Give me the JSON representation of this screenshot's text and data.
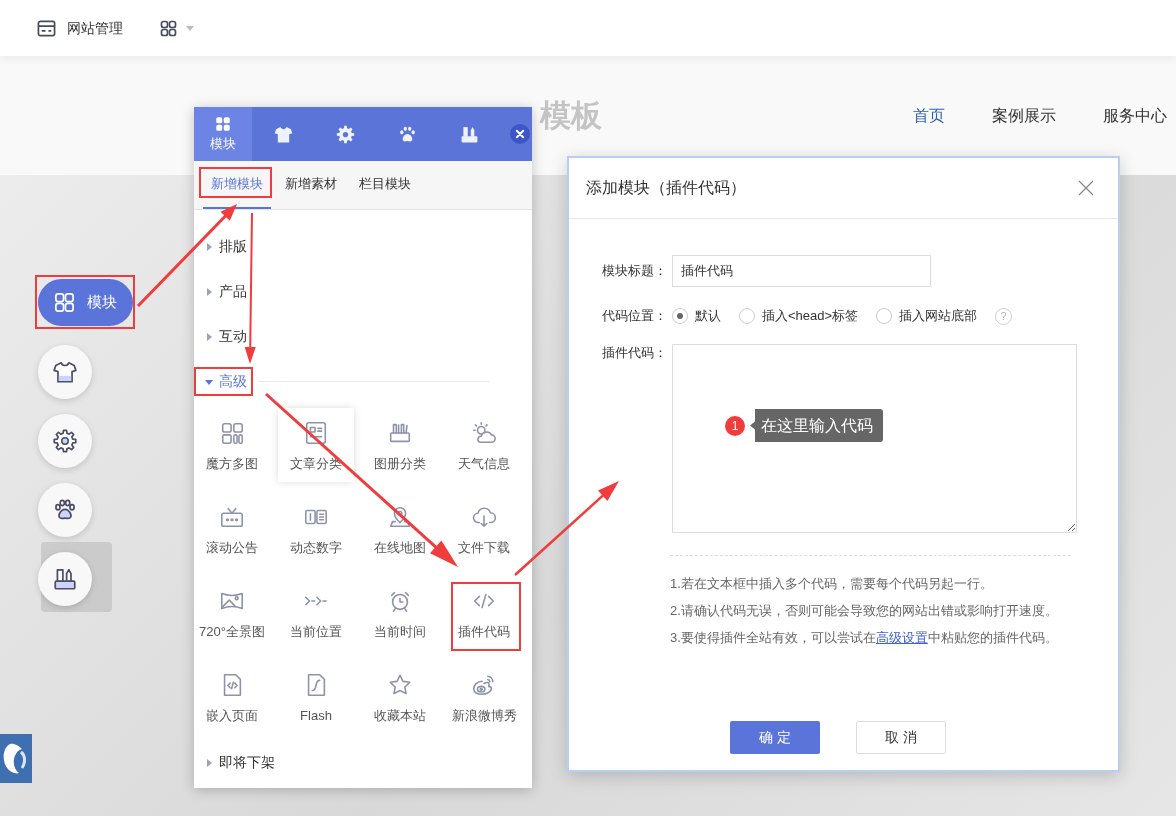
{
  "top_bar": {
    "site_management": "网站管理"
  },
  "site_header": {
    "title": "模板",
    "nav": [
      {
        "label": "首页",
        "selected": true
      },
      {
        "label": "案例展示",
        "selected": false
      },
      {
        "label": "服务中心",
        "selected": false
      }
    ]
  },
  "side_toolbar": [
    {
      "kind": "modules",
      "label": "模块",
      "selected": true,
      "hovered": false,
      "highlighted": true
    },
    {
      "kind": "style",
      "selected": false,
      "hovered": false,
      "highlighted": false
    },
    {
      "kind": "settings",
      "selected": false,
      "hovered": false,
      "highlighted": false
    },
    {
      "kind": "paw",
      "selected": false,
      "hovered": false,
      "highlighted": false
    },
    {
      "kind": "tools",
      "selected": false,
      "hovered": true,
      "highlighted": false
    }
  ],
  "panel": {
    "tabs": [
      {
        "kind": "modules",
        "label": "模块",
        "selected": true
      },
      {
        "kind": "style",
        "selected": false
      },
      {
        "kind": "settings",
        "selected": false
      },
      {
        "kind": "paw",
        "selected": false
      },
      {
        "kind": "tools",
        "selected": false
      }
    ],
    "subtabs": [
      {
        "label": "新增模块",
        "selected": true,
        "highlighted": true
      },
      {
        "label": "新增素材",
        "selected": false,
        "highlighted": false
      },
      {
        "label": "栏目模块",
        "selected": false,
        "highlighted": false
      }
    ],
    "categories": [
      {
        "label": "排版",
        "expanded": false,
        "highlighted": false
      },
      {
        "label": "产品",
        "expanded": false,
        "highlighted": false
      },
      {
        "label": "互动",
        "expanded": false,
        "highlighted": false
      },
      {
        "label": "高级",
        "expanded": true,
        "highlighted": true,
        "items": [
          {
            "kind": "grid",
            "label": "魔方多图",
            "hovered": false,
            "highlighted": false
          },
          {
            "kind": "article",
            "label": "文章分类",
            "hovered": true,
            "highlighted": false
          },
          {
            "kind": "album",
            "label": "图册分类",
            "hovered": false,
            "highlighted": false
          },
          {
            "kind": "weather",
            "label": "天气信息",
            "hovered": false,
            "highlighted": false
          },
          {
            "kind": "notice",
            "label": "滚动公告",
            "hovered": false,
            "highlighted": false
          },
          {
            "kind": "counter",
            "label": "动态数字",
            "hovered": false,
            "highlighted": false
          },
          {
            "kind": "map",
            "label": "在线地图",
            "hovered": false,
            "highlighted": false
          },
          {
            "kind": "download",
            "label": "文件下载",
            "hovered": false,
            "highlighted": false
          },
          {
            "kind": "panorama",
            "label": "720°全景图",
            "hovered": false,
            "highlighted": false
          },
          {
            "kind": "breadcrumb",
            "label": "当前位置",
            "hovered": false,
            "highlighted": false
          },
          {
            "kind": "clock",
            "label": "当前时间",
            "hovered": false,
            "highlighted": false
          },
          {
            "kind": "code",
            "label": "插件代码",
            "hovered": false,
            "highlighted": true
          },
          {
            "kind": "embed",
            "label": "嵌入页面",
            "hovered": false,
            "highlighted": false
          },
          {
            "kind": "flash",
            "label": "Flash",
            "hovered": false,
            "highlighted": false
          },
          {
            "kind": "star",
            "label": "收藏本站",
            "hovered": false,
            "highlighted": false
          },
          {
            "kind": "weibo",
            "label": "新浪微博秀",
            "hovered": false,
            "highlighted": false
          }
        ]
      },
      {
        "label": "即将下架",
        "expanded": false,
        "highlighted": false
      }
    ]
  },
  "dialog": {
    "title": "添加模块（插件代码）",
    "title_field": {
      "label": "模块标题：",
      "value": "插件代码"
    },
    "position_field": {
      "label": "代码位置：",
      "options": [
        {
          "label": "默认",
          "selected": true
        },
        {
          "label": "插入<head>标签",
          "selected": false
        },
        {
          "label": "插入网站底部",
          "selected": false
        }
      ],
      "help": "?"
    },
    "code_field": {
      "label": "插件代码：",
      "hint": {
        "marker": "1",
        "text": "在这里输入代码"
      }
    },
    "notes": [
      {
        "text": "1.若在文本框中插入多个代码，需要每个代码另起一行。"
      },
      {
        "text": "2.请确认代码无误，否则可能会导致您的网站出错或影响打开速度。"
      },
      {
        "text": "3.要使得插件全站有效，可以尝试在",
        "link": "高级设置",
        "after": "中粘贴您的插件代码。"
      }
    ],
    "buttons": [
      {
        "kind": "primary",
        "label": "确 定"
      },
      {
        "kind": "secondary",
        "label": "取 消"
      }
    ]
  }
}
